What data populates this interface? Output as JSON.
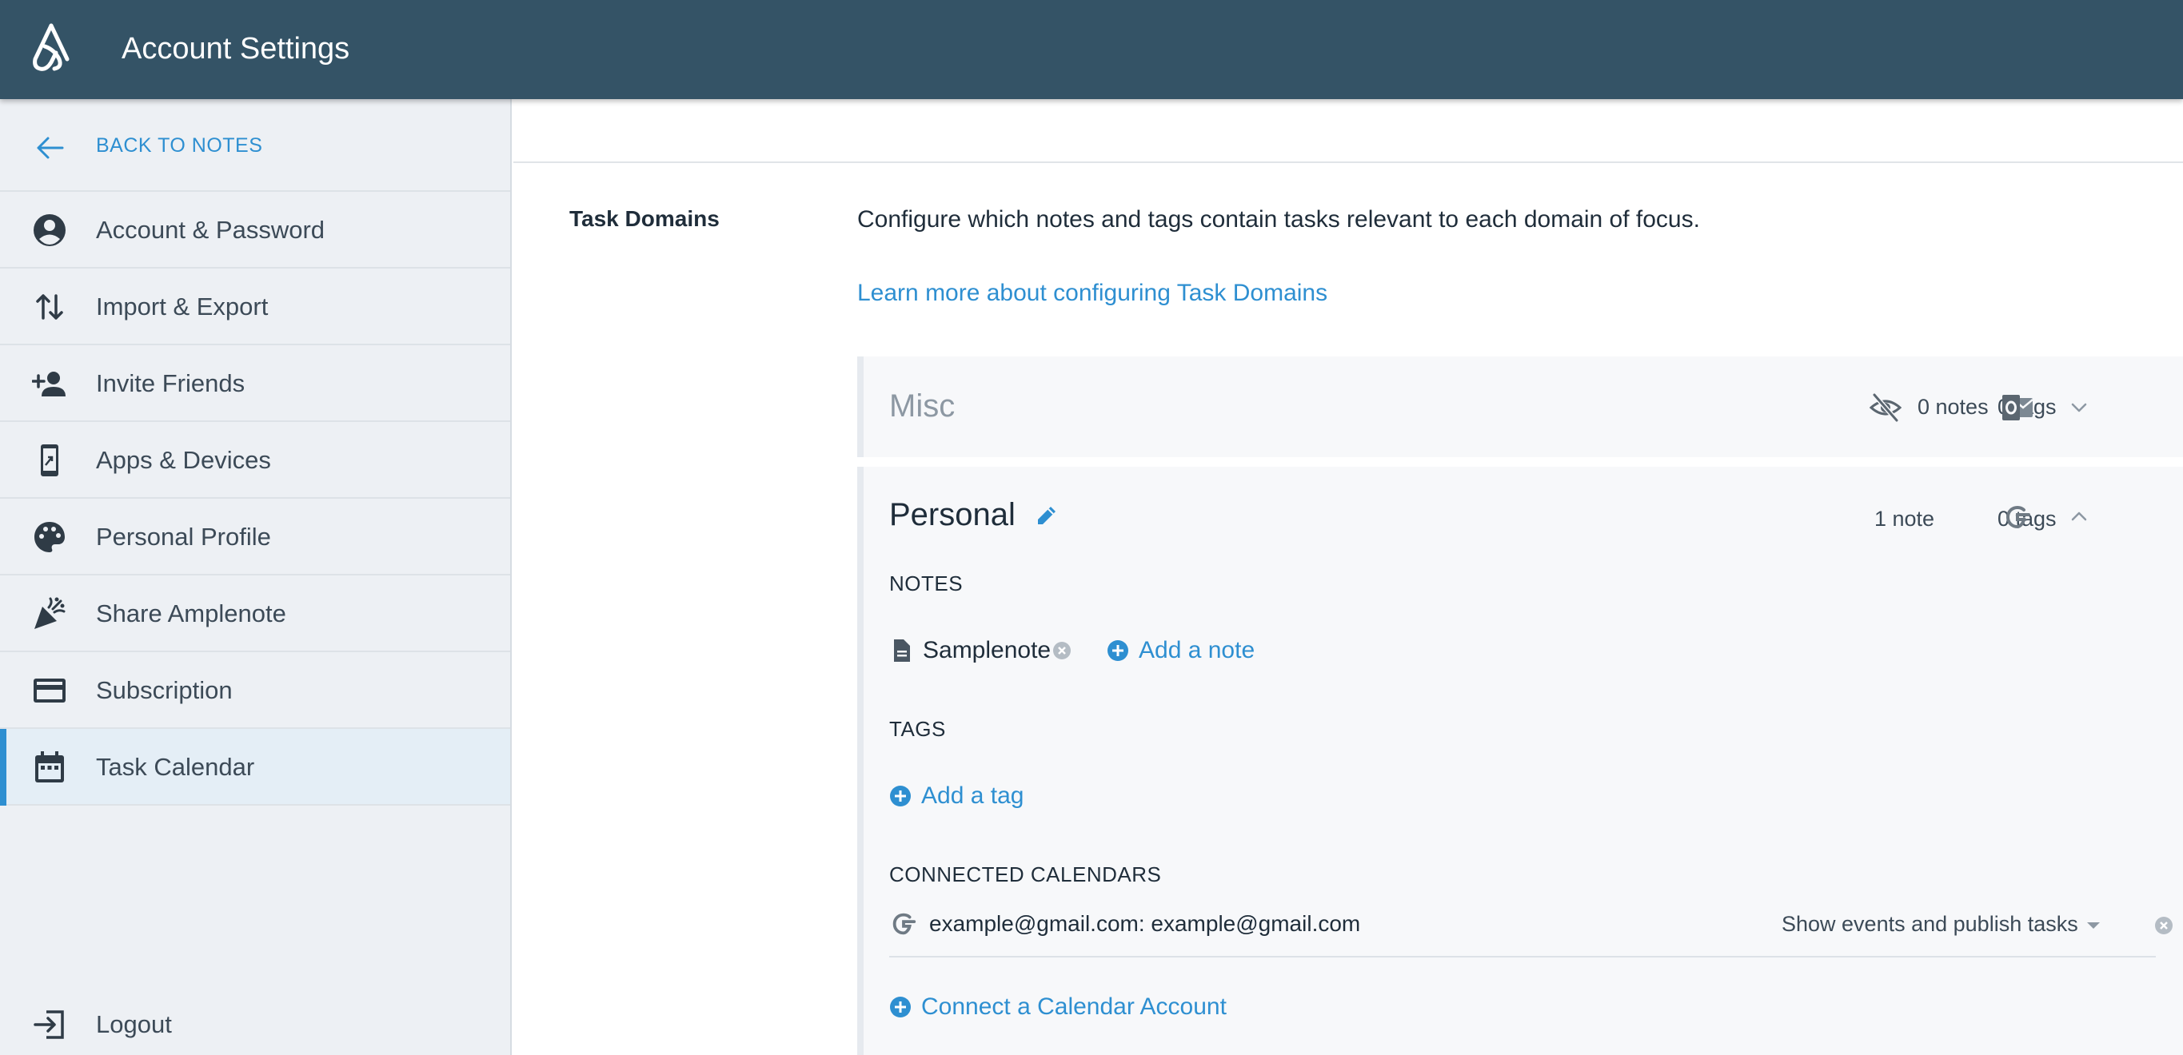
{
  "header": {
    "title": "Account Settings",
    "logo": "amplenote-logo"
  },
  "sidebar": {
    "back_label": "BACK TO NOTES",
    "items": [
      {
        "label": "Account & Password",
        "icon": "account-circle-icon",
        "active": false
      },
      {
        "label": "Import & Export",
        "icon": "swap-vertical-icon",
        "active": false
      },
      {
        "label": "Invite Friends",
        "icon": "person-add-icon",
        "active": false
      },
      {
        "label": "Apps & Devices",
        "icon": "phone-link-icon",
        "active": false
      },
      {
        "label": "Personal Profile",
        "icon": "palette-icon",
        "active": false
      },
      {
        "label": "Share Amplenote",
        "icon": "celebration-icon",
        "active": false
      },
      {
        "label": "Subscription",
        "icon": "credit-card-icon",
        "active": false
      },
      {
        "label": "Task Calendar",
        "icon": "calendar-icon",
        "active": true
      }
    ],
    "logout_label": "Logout"
  },
  "main": {
    "section_label": "Task Domains",
    "description": "Configure which notes and tags contain tasks relevant to each domain of focus.",
    "learn_more": "Learn more about configuring Task Domains",
    "domains": [
      {
        "name": "Misc",
        "notes_count": "0 notes",
        "tags_count": "0 tags",
        "expanded": false
      },
      {
        "name": "Personal",
        "notes_count": "1 note",
        "tags_count": "0 tags",
        "expanded": true,
        "notes_heading": "NOTES",
        "notes": [
          "Samplenote"
        ],
        "add_note": "Add a note",
        "tags_heading": "TAGS",
        "add_tag": "Add a tag",
        "calendars_heading": "CONNECTED CALENDARS",
        "calendar_account": "example@gmail.com: example@gmail.com",
        "calendar_mode": "Show events and publish tasks",
        "connect_calendar": "Connect a Calendar Account"
      }
    ]
  },
  "colors": {
    "header": "#345366",
    "accent": "#2e8fd1",
    "sidebar": "#edf0f4"
  }
}
